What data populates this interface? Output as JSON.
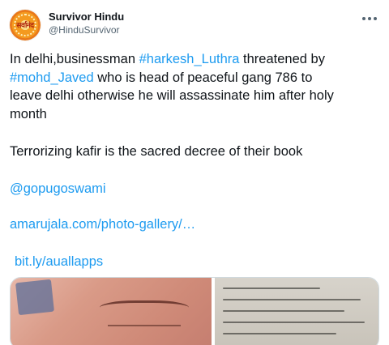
{
  "author": {
    "display_name": "Survivor Hindu",
    "handle": "@HinduSurvivor",
    "avatar_text": "सर्वानंद"
  },
  "tweet": {
    "line1_prefix": "In delhi,businessman ",
    "hashtag1": "#harkesh_Luthra",
    "line1_suffix": " threatened by",
    "hashtag2": "#mohd_Javed",
    "line2_suffix": " who is head of peaceful gang 786 to",
    "line3": "leave delhi otherwise he will assassinate him after holy",
    "line4": "month",
    "paragraph2": "Terrorizing kafir is the sacred decree of their book",
    "mention": "@gopugoswami",
    "link1": "amarujala.com/photo-gallery/…",
    "link2": "bit.ly/auallapps"
  },
  "colors": {
    "link": "#1d9bf0",
    "text": "#0f1419",
    "muted": "#536471"
  },
  "icons": {
    "more": "more-dots-icon"
  }
}
